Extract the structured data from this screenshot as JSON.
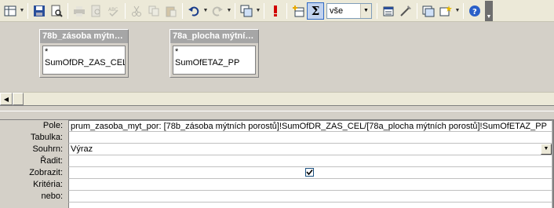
{
  "toolbar": {
    "buttons": [
      {
        "name": "view-icon"
      },
      {
        "name": "save-icon"
      },
      {
        "name": "search-file-icon"
      },
      {
        "name": "print-icon"
      },
      {
        "name": "print-preview-icon"
      },
      {
        "name": "spellcheck-icon"
      },
      {
        "name": "cut-icon"
      },
      {
        "name": "copy-icon"
      },
      {
        "name": "paste-icon"
      },
      {
        "name": "undo-icon"
      },
      {
        "name": "redo-icon"
      },
      {
        "name": "query-type-icon"
      },
      {
        "name": "run-icon"
      },
      {
        "name": "show-table-icon"
      },
      {
        "name": "totals-icon"
      },
      {
        "name": "properties-icon"
      },
      {
        "name": "build-icon"
      },
      {
        "name": "database-window-icon"
      },
      {
        "name": "new-object-icon"
      },
      {
        "name": "help-icon"
      }
    ],
    "top_values": "vše",
    "totals_label": "Σ"
  },
  "tables": [
    {
      "title": "78b_zásoba mýtn…",
      "fields": [
        "*",
        "SumOfDR_ZAS_CEL"
      ]
    },
    {
      "title": "78a_plocha mýtní…",
      "fields": [
        "*",
        "SumOfETAZ_PP"
      ]
    }
  ],
  "grid": {
    "rows": [
      {
        "label": "Pole:",
        "value": "prum_zasoba_myt_por: [78b_zásoba mýtních porostů]!SumOfDR_ZAS_CEL/[78a_plocha mýtních porostů]!SumOfETAZ_PP"
      },
      {
        "label": "Tabulka:",
        "value": ""
      },
      {
        "label": "Souhrn:",
        "value": "Výraz"
      },
      {
        "label": "Řadit:",
        "value": ""
      },
      {
        "label": "Zobrazit:",
        "value": ""
      },
      {
        "label": "Kritéria:",
        "value": ""
      },
      {
        "label": "nebo:",
        "value": ""
      }
    ],
    "show_checked": true
  }
}
